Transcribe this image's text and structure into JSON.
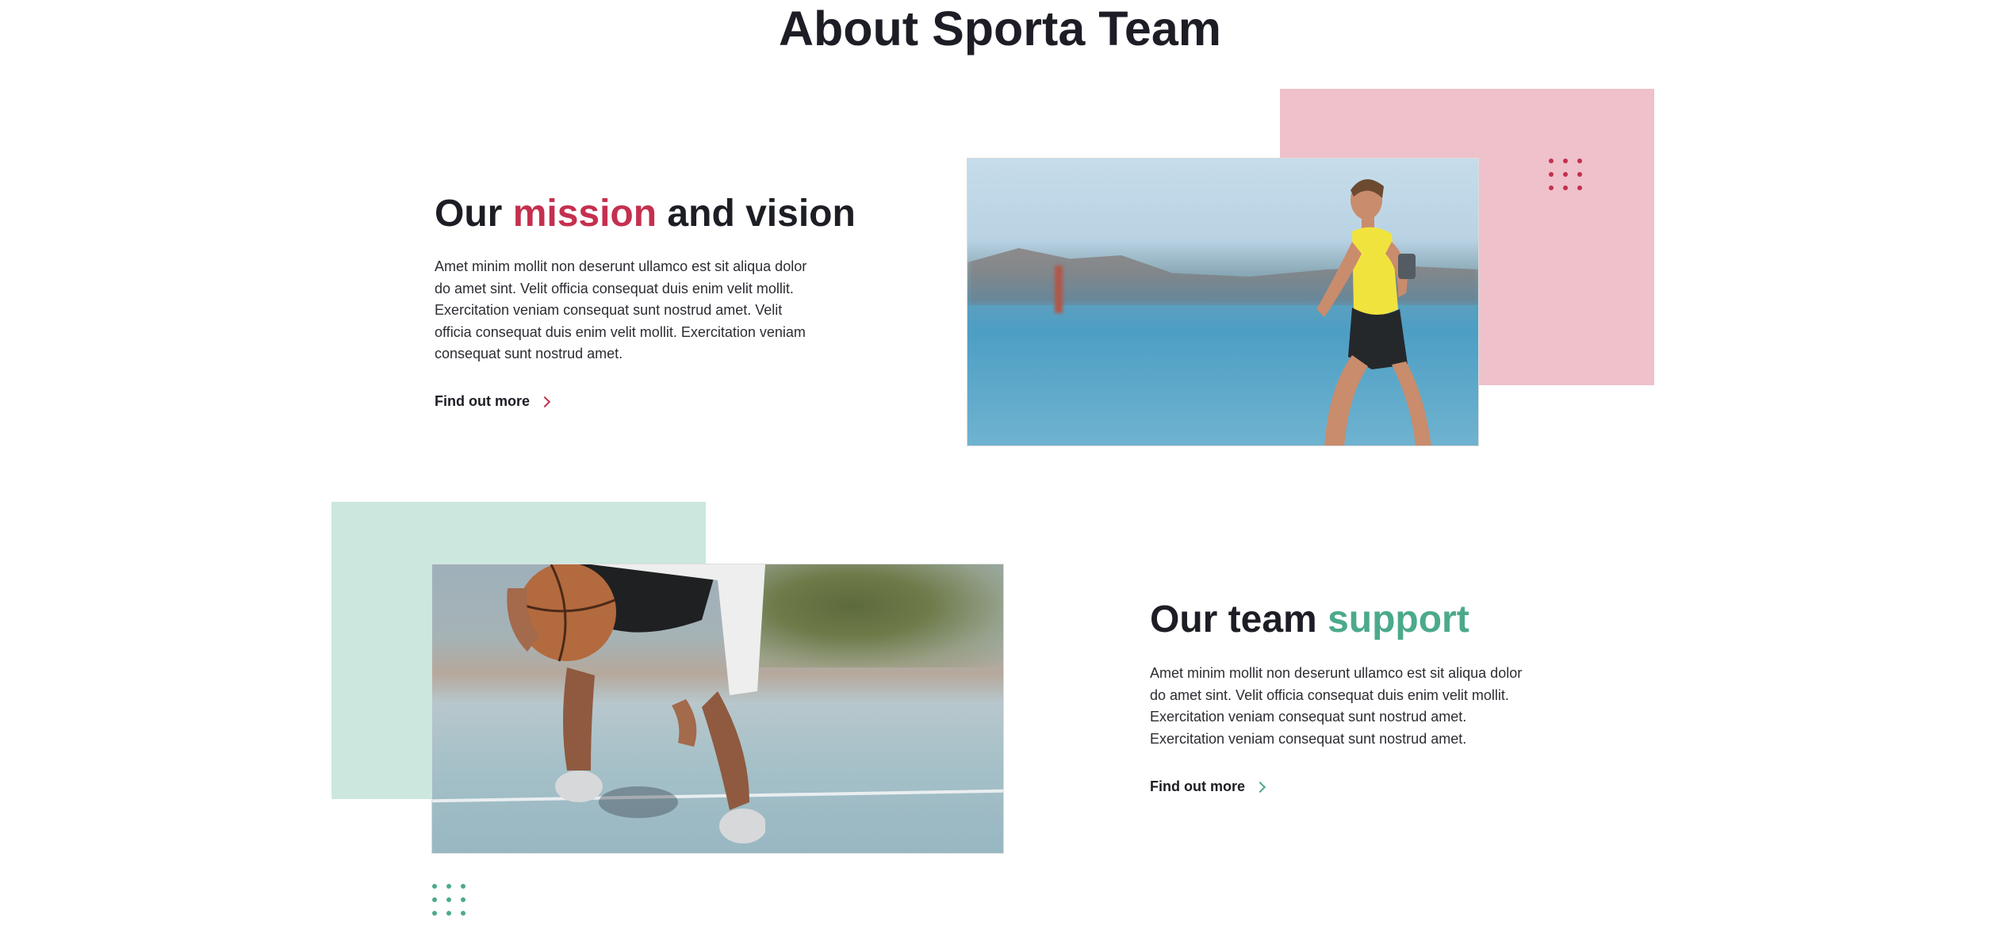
{
  "page": {
    "title": "About Sporta Team"
  },
  "mission": {
    "heading_before": "Our",
    "heading_accent": "mission",
    "heading_after": "and vision",
    "body": "Amet minim mollit non deserunt ullamco est sit aliqua dolor do amet sint. Velit officia consequat duis enim velit mollit. Exercitation veniam consequat sunt nostrud amet. Velit officia consequat duis enim velit mollit. Exercitation veniam consequat sunt nostrud amet.",
    "link_label": "Find out more",
    "link_icon": "chevron-right-icon",
    "image": "runner-photo",
    "accent_color": "#c4304f",
    "block_color": "#efc1ca"
  },
  "team": {
    "heading_before": "Our team",
    "heading_accent": "support",
    "body": "Amet minim mollit non deserunt ullamco est sit aliqua dolor do amet sint. Velit officia consequat duis enim velit mollit. Exercitation veniam consequat sunt nostrud amet. Exercitation veniam consequat sunt nostrud amet.",
    "link_label": "Find out more",
    "link_icon": "chevron-right-icon",
    "image": "basketball-photo",
    "accent_color": "#4ca98c",
    "block_color": "#cce7de"
  },
  "colors": {
    "text": "#1d1e25",
    "background": "#ffffff"
  }
}
